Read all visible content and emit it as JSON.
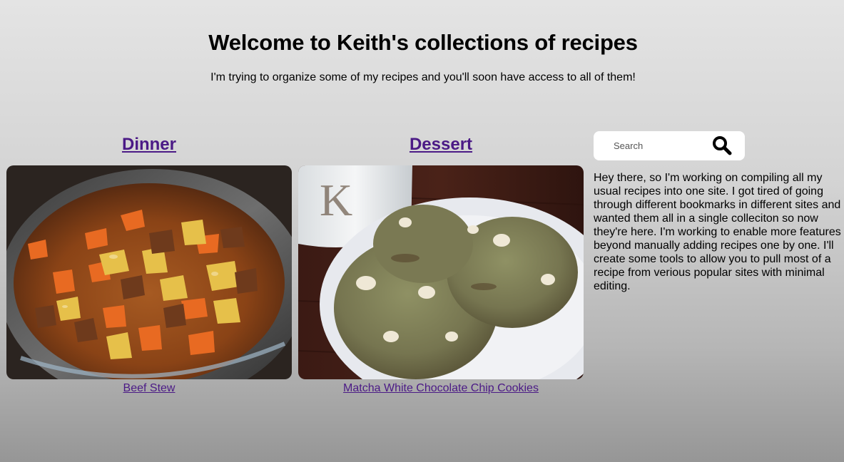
{
  "header": {
    "title": "Welcome to Keith's collections of recipes",
    "subtitle": "I'm trying to organize some of my recipes and you'll soon have access to all of them!"
  },
  "categories": [
    {
      "heading": "Dinner",
      "recipe": "Beef Stew"
    },
    {
      "heading": "Dessert",
      "recipe": "Matcha White Chocolate Chip Cookies"
    }
  ],
  "search": {
    "placeholder": "Search"
  },
  "intro": "Hey there, so I'm working on compiling all my usual recipes into one site. I got tired of going through different bookmarks in different sites and wanted them all in a single colleciton so now they're here. I'm working to enable more features beyond manually adding recipes one by one. I'll create some tools to allow you to pull most of a recipe from verious popular sites with minimal editing.",
  "colors": {
    "link": "#4b1a86",
    "search_bg": "#ffffff"
  },
  "icons": {
    "search": "search-icon"
  }
}
